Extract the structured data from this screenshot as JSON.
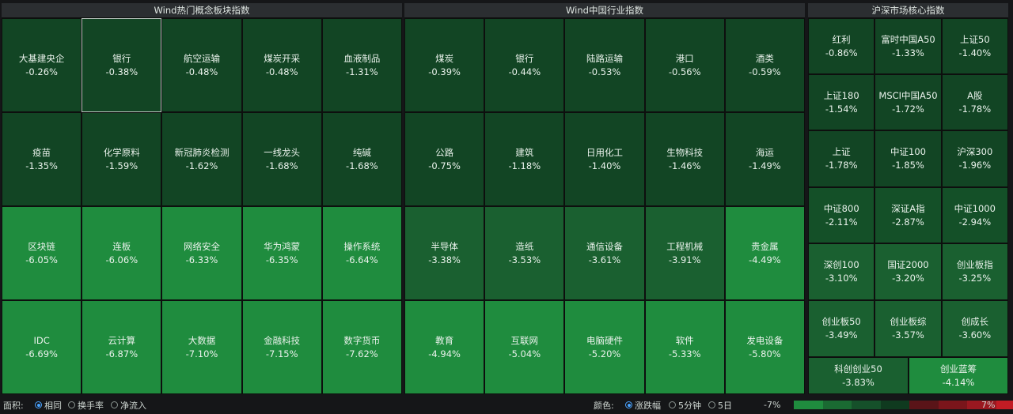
{
  "panels": {
    "concept": {
      "title": "Wind热门概念板块指数",
      "rows": [
        [
          {
            "name": "大基建央企",
            "value": "-0.26%",
            "color": "#124524"
          },
          {
            "name": "银行",
            "value": "-0.38%",
            "color": "#124524"
          },
          {
            "name": "航空运输",
            "value": "-0.48%",
            "color": "#124524"
          },
          {
            "name": "煤炭开采",
            "value": "-0.48%",
            "color": "#124524"
          },
          {
            "name": "血液制品",
            "value": "-1.31%",
            "color": "#124524"
          }
        ],
        [
          {
            "name": "疫苗",
            "value": "-1.35%",
            "color": "#124524"
          },
          {
            "name": "化学原料",
            "value": "-1.59%",
            "color": "#124524"
          },
          {
            "name": "新冠肺炎检测",
            "value": "-1.62%",
            "color": "#124524"
          },
          {
            "name": "一线龙头",
            "value": "-1.68%",
            "color": "#124524"
          },
          {
            "name": "纯碱",
            "value": "-1.68%",
            "color": "#124524"
          }
        ],
        [
          {
            "name": "区块链",
            "value": "-6.05%",
            "color": "#1f8c3e"
          },
          {
            "name": "连板",
            "value": "-6.06%",
            "color": "#1f8c3e"
          },
          {
            "name": "网络安全",
            "value": "-6.33%",
            "color": "#1f8c3e"
          },
          {
            "name": "华为鸿蒙",
            "value": "-6.35%",
            "color": "#1f8c3e"
          },
          {
            "name": "操作系统",
            "value": "-6.64%",
            "color": "#1f8c3e"
          }
        ],
        [
          {
            "name": "IDC",
            "value": "-6.69%",
            "color": "#1f8c3e"
          },
          {
            "name": "云计算",
            "value": "-6.87%",
            "color": "#1f8c3e"
          },
          {
            "name": "大数据",
            "value": "-7.10%",
            "color": "#1f8c3e"
          },
          {
            "name": "金融科技",
            "value": "-7.15%",
            "color": "#1f8c3e"
          },
          {
            "name": "数字货币",
            "value": "-7.62%",
            "color": "#1f8c3e"
          }
        ]
      ]
    },
    "industry": {
      "title": "Wind中国行业指数",
      "rows": [
        [
          {
            "name": "煤炭",
            "value": "-0.39%",
            "color": "#124524"
          },
          {
            "name": "银行",
            "value": "-0.44%",
            "color": "#124524"
          },
          {
            "name": "陆路运输",
            "value": "-0.53%",
            "color": "#124524"
          },
          {
            "name": "港口",
            "value": "-0.56%",
            "color": "#124524"
          },
          {
            "name": "酒类",
            "value": "-0.59%",
            "color": "#124524"
          }
        ],
        [
          {
            "name": "公路",
            "value": "-0.75%",
            "color": "#124524"
          },
          {
            "name": "建筑",
            "value": "-1.18%",
            "color": "#124524"
          },
          {
            "name": "日用化工",
            "value": "-1.40%",
            "color": "#124524"
          },
          {
            "name": "生物科技",
            "value": "-1.46%",
            "color": "#124524"
          },
          {
            "name": "海运",
            "value": "-1.49%",
            "color": "#124524"
          }
        ],
        [
          {
            "name": "半导体",
            "value": "-3.38%",
            "color": "#1a6030"
          },
          {
            "name": "造纸",
            "value": "-3.53%",
            "color": "#1a6030"
          },
          {
            "name": "通信设备",
            "value": "-3.61%",
            "color": "#1a6030"
          },
          {
            "name": "工程机械",
            "value": "-3.91%",
            "color": "#1a6030"
          },
          {
            "name": "贵金属",
            "value": "-4.49%",
            "color": "#1f8c3e"
          }
        ],
        [
          {
            "name": "教育",
            "value": "-4.94%",
            "color": "#1f8c3e"
          },
          {
            "name": "互联网",
            "value": "-5.04%",
            "color": "#1f8c3e"
          },
          {
            "name": "电脑硬件",
            "value": "-5.20%",
            "color": "#1f8c3e"
          },
          {
            "name": "软件",
            "value": "-5.33%",
            "color": "#1f8c3e"
          },
          {
            "name": "发电设备",
            "value": "-5.80%",
            "color": "#1f8c3e"
          }
        ]
      ]
    },
    "core": {
      "title": "沪深市场核心指数",
      "rows": [
        [
          {
            "name": "红利",
            "value": "-0.86%",
            "color": "#124524"
          },
          {
            "name": "富时中国A50",
            "value": "-1.33%",
            "color": "#124524"
          },
          {
            "name": "上证50",
            "value": "-1.40%",
            "color": "#124524"
          }
        ],
        [
          {
            "name": "上证180",
            "value": "-1.54%",
            "color": "#124524"
          },
          {
            "name": "MSCI中国A50",
            "value": "-1.72%",
            "color": "#124524"
          },
          {
            "name": "A股",
            "value": "-1.78%",
            "color": "#124524"
          }
        ],
        [
          {
            "name": "上证",
            "value": "-1.78%",
            "color": "#124524"
          },
          {
            "name": "中证100",
            "value": "-1.85%",
            "color": "#124524"
          },
          {
            "name": "沪深300",
            "value": "-1.96%",
            "color": "#124524"
          }
        ],
        [
          {
            "name": "中证800",
            "value": "-2.11%",
            "color": "#145028"
          },
          {
            "name": "深证A指",
            "value": "-2.87%",
            "color": "#145028"
          },
          {
            "name": "中证1000",
            "value": "-2.94%",
            "color": "#145028"
          }
        ],
        [
          {
            "name": "深创100",
            "value": "-3.10%",
            "color": "#1a6030"
          },
          {
            "name": "国证2000",
            "value": "-3.20%",
            "color": "#1a6030"
          },
          {
            "name": "创业板指",
            "value": "-3.25%",
            "color": "#1a6030"
          }
        ],
        [
          {
            "name": "创业板50",
            "value": "-3.49%",
            "color": "#1a6030"
          },
          {
            "name": "创业板综",
            "value": "-3.57%",
            "color": "#1a6030"
          },
          {
            "name": "创成长",
            "value": "-3.60%",
            "color": "#1a6030"
          }
        ],
        [
          {
            "name": "科创创业50",
            "value": "-3.83%",
            "color": "#1a6030"
          },
          {
            "name": "创业蓝筹",
            "value": "-4.14%",
            "color": "#1f8c3e"
          }
        ]
      ]
    }
  },
  "footer": {
    "area_label": "面积:",
    "area_options": [
      "相同",
      "换手率",
      "净流入"
    ],
    "area_selected": 0,
    "color_label": "颜色:",
    "color_options": [
      "涨跌幅",
      "5分钟",
      "5日"
    ],
    "color_selected": 0,
    "legend_min": "-7%",
    "legend_max": "7%",
    "legend_colors": [
      "#1f8c3e",
      "#1a6a32",
      "#15502a",
      "#0f3a1f",
      "#5a1418",
      "#7a151b",
      "#9a1820",
      "#c21c24"
    ]
  },
  "selected_cell": "concept-0-1"
}
